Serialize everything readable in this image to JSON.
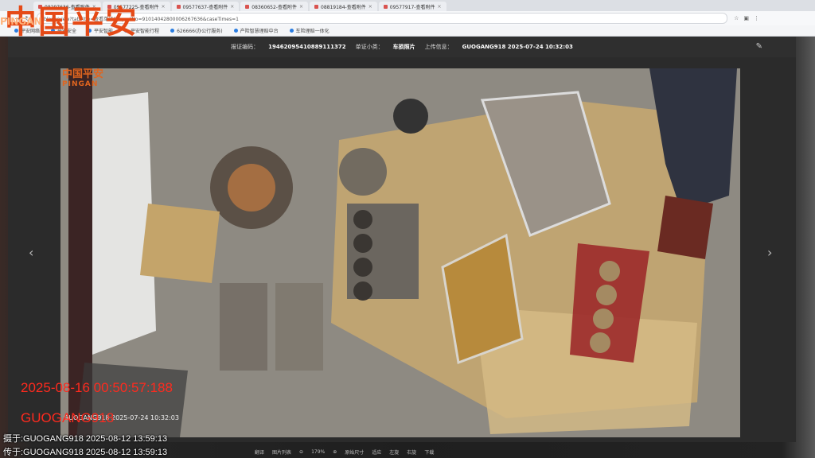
{
  "tabs": [
    {
      "label": "08297636-查看附件"
    },
    {
      "label": "09577225-查看附件"
    },
    {
      "label": "09577637-查看附件"
    },
    {
      "label": "08360652-查看附件"
    },
    {
      "label": "08819184-查看附件"
    },
    {
      "label": "09577917-查看附件"
    }
  ],
  "address": {
    "url": "/blank/view?tabTitle=查看单证&reportNo=91014042800006267636&caseTimes=1"
  },
  "bookmarks": [
    {
      "label": "平安网络"
    },
    {
      "label": "平安安全"
    },
    {
      "label": "平安智能"
    },
    {
      "label": "平安智能行程"
    },
    {
      "label": "626666(办公行服务)"
    },
    {
      "label": "产险智慧理赔中台"
    },
    {
      "label": "车险理赔一体化"
    }
  ],
  "info_bar": {
    "report_label": "报证编码：",
    "report_value": "19462095410889111372",
    "category_label": "单证小类：",
    "category_value": "车损照片",
    "upload_label": "上传信息：",
    "upload_value": "GUOGANG918 2025-07-24 10:32:03"
  },
  "photo": {
    "watermark_top": "中国平安",
    "watermark_sub": "PINGAN",
    "caption": "GUOGANG918 2025-07-24 10:32:03"
  },
  "toolbar": {
    "items": [
      "翻译",
      "图片列表",
      "179%",
      "原始尺寸",
      "适应",
      "左旋",
      "右旋",
      "下载"
    ]
  },
  "overlay": {
    "brand": "中国平安",
    "brand_sub": "PINGAN",
    "timestamp": "2025-08-16 00:50:57:188",
    "user": "GUOGANG918",
    "shot_by": "摄于:GUOGANG918 2025-08-12 13:59:13",
    "sent_by": "传于:GUOGANG918 2025-08-12 13:59:13"
  }
}
